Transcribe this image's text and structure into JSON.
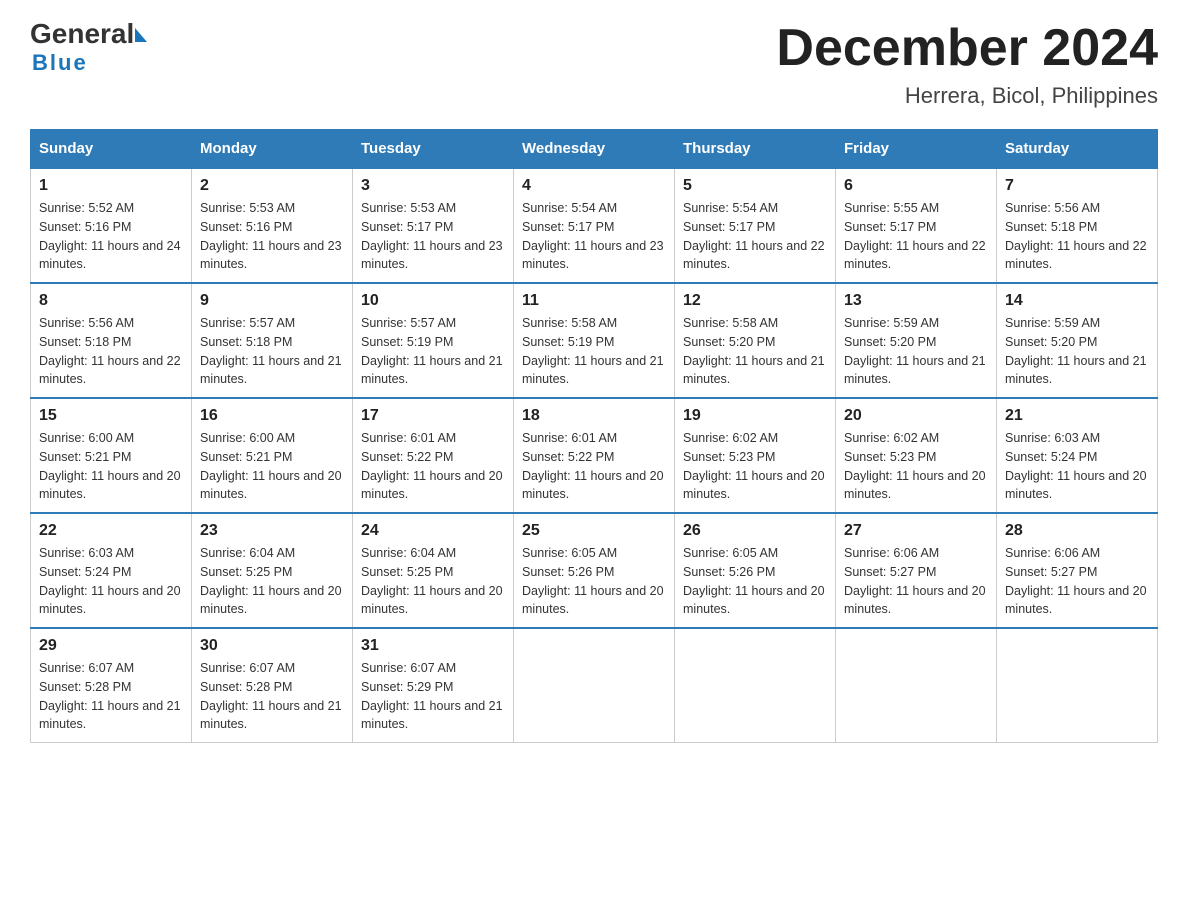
{
  "logo": {
    "general": "General",
    "blue": "Blue"
  },
  "title": "December 2024",
  "subtitle": "Herrera, Bicol, Philippines",
  "days_of_week": [
    "Sunday",
    "Monday",
    "Tuesday",
    "Wednesday",
    "Thursday",
    "Friday",
    "Saturday"
  ],
  "weeks": [
    [
      {
        "day": "1",
        "sunrise": "5:52 AM",
        "sunset": "5:16 PM",
        "daylight": "11 hours and 24 minutes."
      },
      {
        "day": "2",
        "sunrise": "5:53 AM",
        "sunset": "5:16 PM",
        "daylight": "11 hours and 23 minutes."
      },
      {
        "day": "3",
        "sunrise": "5:53 AM",
        "sunset": "5:17 PM",
        "daylight": "11 hours and 23 minutes."
      },
      {
        "day": "4",
        "sunrise": "5:54 AM",
        "sunset": "5:17 PM",
        "daylight": "11 hours and 23 minutes."
      },
      {
        "day": "5",
        "sunrise": "5:54 AM",
        "sunset": "5:17 PM",
        "daylight": "11 hours and 22 minutes."
      },
      {
        "day": "6",
        "sunrise": "5:55 AM",
        "sunset": "5:17 PM",
        "daylight": "11 hours and 22 minutes."
      },
      {
        "day": "7",
        "sunrise": "5:56 AM",
        "sunset": "5:18 PM",
        "daylight": "11 hours and 22 minutes."
      }
    ],
    [
      {
        "day": "8",
        "sunrise": "5:56 AM",
        "sunset": "5:18 PM",
        "daylight": "11 hours and 22 minutes."
      },
      {
        "day": "9",
        "sunrise": "5:57 AM",
        "sunset": "5:18 PM",
        "daylight": "11 hours and 21 minutes."
      },
      {
        "day": "10",
        "sunrise": "5:57 AM",
        "sunset": "5:19 PM",
        "daylight": "11 hours and 21 minutes."
      },
      {
        "day": "11",
        "sunrise": "5:58 AM",
        "sunset": "5:19 PM",
        "daylight": "11 hours and 21 minutes."
      },
      {
        "day": "12",
        "sunrise": "5:58 AM",
        "sunset": "5:20 PM",
        "daylight": "11 hours and 21 minutes."
      },
      {
        "day": "13",
        "sunrise": "5:59 AM",
        "sunset": "5:20 PM",
        "daylight": "11 hours and 21 minutes."
      },
      {
        "day": "14",
        "sunrise": "5:59 AM",
        "sunset": "5:20 PM",
        "daylight": "11 hours and 21 minutes."
      }
    ],
    [
      {
        "day": "15",
        "sunrise": "6:00 AM",
        "sunset": "5:21 PM",
        "daylight": "11 hours and 20 minutes."
      },
      {
        "day": "16",
        "sunrise": "6:00 AM",
        "sunset": "5:21 PM",
        "daylight": "11 hours and 20 minutes."
      },
      {
        "day": "17",
        "sunrise": "6:01 AM",
        "sunset": "5:22 PM",
        "daylight": "11 hours and 20 minutes."
      },
      {
        "day": "18",
        "sunrise": "6:01 AM",
        "sunset": "5:22 PM",
        "daylight": "11 hours and 20 minutes."
      },
      {
        "day": "19",
        "sunrise": "6:02 AM",
        "sunset": "5:23 PM",
        "daylight": "11 hours and 20 minutes."
      },
      {
        "day": "20",
        "sunrise": "6:02 AM",
        "sunset": "5:23 PM",
        "daylight": "11 hours and 20 minutes."
      },
      {
        "day": "21",
        "sunrise": "6:03 AM",
        "sunset": "5:24 PM",
        "daylight": "11 hours and 20 minutes."
      }
    ],
    [
      {
        "day": "22",
        "sunrise": "6:03 AM",
        "sunset": "5:24 PM",
        "daylight": "11 hours and 20 minutes."
      },
      {
        "day": "23",
        "sunrise": "6:04 AM",
        "sunset": "5:25 PM",
        "daylight": "11 hours and 20 minutes."
      },
      {
        "day": "24",
        "sunrise": "6:04 AM",
        "sunset": "5:25 PM",
        "daylight": "11 hours and 20 minutes."
      },
      {
        "day": "25",
        "sunrise": "6:05 AM",
        "sunset": "5:26 PM",
        "daylight": "11 hours and 20 minutes."
      },
      {
        "day": "26",
        "sunrise": "6:05 AM",
        "sunset": "5:26 PM",
        "daylight": "11 hours and 20 minutes."
      },
      {
        "day": "27",
        "sunrise": "6:06 AM",
        "sunset": "5:27 PM",
        "daylight": "11 hours and 20 minutes."
      },
      {
        "day": "28",
        "sunrise": "6:06 AM",
        "sunset": "5:27 PM",
        "daylight": "11 hours and 20 minutes."
      }
    ],
    [
      {
        "day": "29",
        "sunrise": "6:07 AM",
        "sunset": "5:28 PM",
        "daylight": "11 hours and 21 minutes."
      },
      {
        "day": "30",
        "sunrise": "6:07 AM",
        "sunset": "5:28 PM",
        "daylight": "11 hours and 21 minutes."
      },
      {
        "day": "31",
        "sunrise": "6:07 AM",
        "sunset": "5:29 PM",
        "daylight": "11 hours and 21 minutes."
      },
      null,
      null,
      null,
      null
    ]
  ],
  "labels": {
    "sunrise": "Sunrise:",
    "sunset": "Sunset:",
    "daylight": "Daylight:"
  }
}
